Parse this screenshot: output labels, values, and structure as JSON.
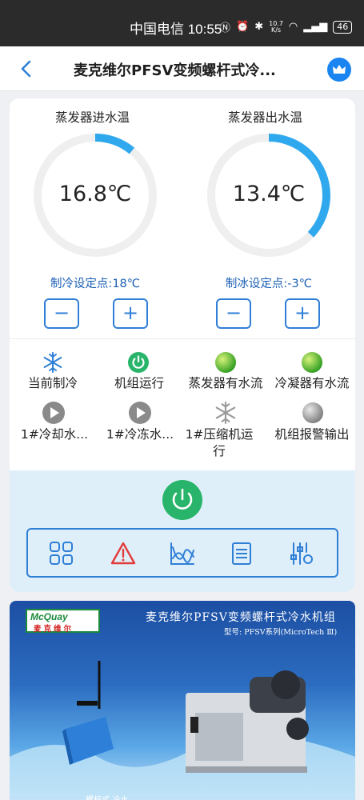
{
  "status_bar": {
    "text": "中国电信 10:55",
    "net_speed_value": "10.7",
    "net_speed_unit": "K/s",
    "battery": "46"
  },
  "header": {
    "title": "麦克维尔PFSV变频螺杆式冷..."
  },
  "gauges": [
    {
      "title": "蒸发器进水温",
      "value": "16.8℃",
      "fill_fraction": 0.11,
      "setpoint_label": "制冷设定点:18℃"
    },
    {
      "title": "蒸发器出水温",
      "value": "13.4℃",
      "fill_fraction": 0.37,
      "setpoint_label": "制冰设定点:-3℃"
    }
  ],
  "stepper": {
    "minus": "−",
    "plus": "+"
  },
  "status_items": [
    {
      "label": "当前制冷",
      "icon": "snowflake-icon"
    },
    {
      "label": "机组运行",
      "icon": "power-icon"
    },
    {
      "label": "蒸发器有水流",
      "icon": "green-dot-icon"
    },
    {
      "label": "冷凝器有水流",
      "icon": "green-dot-icon"
    },
    {
      "label": "1#冷却水...",
      "icon": "play-icon"
    },
    {
      "label": "1#冷冻水...",
      "icon": "play-icon"
    },
    {
      "label": "1#压缩机运行",
      "icon": "snowflake-icon"
    },
    {
      "label": "机组报警输出",
      "icon": "gray-dot-icon"
    }
  ],
  "toolbar": [
    {
      "name": "grid-icon"
    },
    {
      "name": "alarm-icon"
    },
    {
      "name": "chart-icon"
    },
    {
      "name": "list-icon"
    },
    {
      "name": "settings-icon"
    }
  ],
  "banner": {
    "logo_top": "McQuay",
    "logo_bottom": "麦克维尔",
    "title": "麦克维尔PFSV变频螺杆式冷水机组",
    "subtitle": "型号: PFSV系列(MicroTech Ⅲ)",
    "bottom_text": "…………………… 螺杆式 冷水 ……"
  },
  "colors": {
    "accent": "#2f7fd6",
    "gauge_fill": "#2fa8ee",
    "run_green": "#28b46a",
    "panel_bg": "#dfeff9"
  }
}
